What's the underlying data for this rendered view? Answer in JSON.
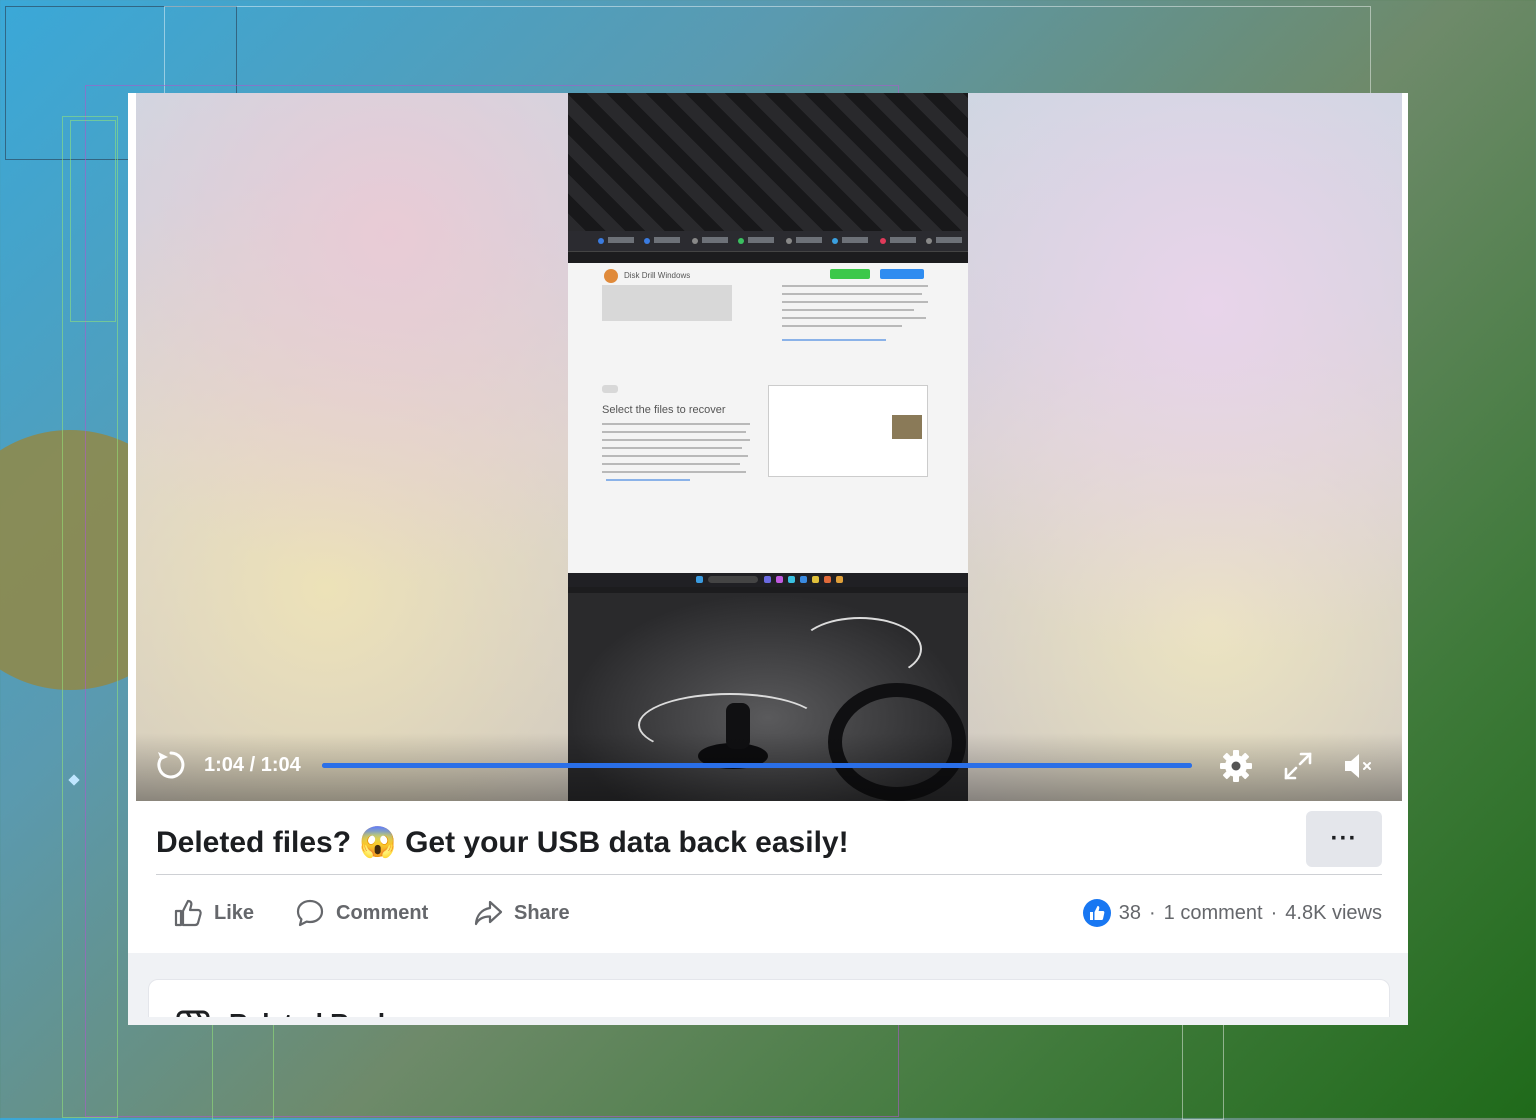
{
  "video": {
    "time_display": "1:04 / 1:04",
    "progress": 1.0,
    "accent_color": "#2a6fe8",
    "embedded_screen": {
      "site_title": "Disk Drill Windows",
      "heading": "Select the files to recover",
      "primary_button_color": "#3cc84a",
      "secondary_button_color": "#2f8cf0"
    },
    "icons": {
      "replay": "replay-icon",
      "settings": "gear-icon",
      "fullscreen": "fullscreen-icon",
      "volume": "volume-muted-icon"
    }
  },
  "post": {
    "title_text": "Deleted files? 😱 Get your USB data back easily!",
    "more_label": "···"
  },
  "actions": {
    "like_label": "Like",
    "comment_label": "Comment",
    "share_label": "Share"
  },
  "stats": {
    "likes": "38",
    "comments": "1 comment",
    "views": "4.8K views",
    "separator": "·"
  },
  "related": {
    "title": "Related Reels"
  }
}
